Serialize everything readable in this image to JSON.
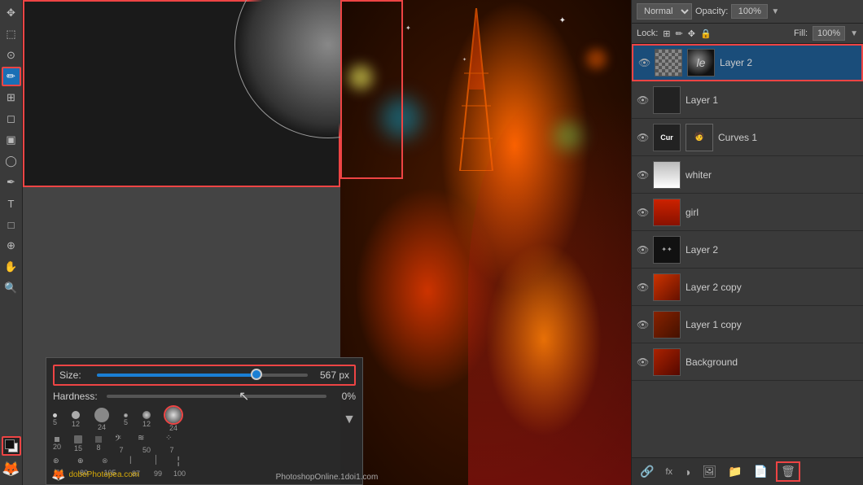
{
  "toolbar": {
    "tools": [
      {
        "name": "move",
        "icon": "✥",
        "active": false
      },
      {
        "name": "marquee",
        "icon": "⬚",
        "active": false
      },
      {
        "name": "lasso",
        "icon": "⊙",
        "active": false
      },
      {
        "name": "brush",
        "icon": "✏",
        "active": true
      },
      {
        "name": "eraser",
        "icon": "◻",
        "active": false
      },
      {
        "name": "gradient",
        "icon": "▣",
        "active": false
      },
      {
        "name": "dodge",
        "icon": "◯",
        "active": false
      },
      {
        "name": "pen",
        "icon": "✒",
        "active": false
      },
      {
        "name": "text",
        "icon": "T",
        "active": false
      },
      {
        "name": "shape",
        "icon": "□",
        "active": false
      },
      {
        "name": "zoom",
        "icon": "🔍",
        "active": false
      },
      {
        "name": "hand",
        "icon": "✋",
        "active": false
      },
      {
        "name": "zoom2",
        "icon": "⊕",
        "active": false
      }
    ]
  },
  "brush": {
    "size_label": "Size:",
    "size_value": "567 px",
    "size_percent": 75,
    "hardness_label": "Hardness:",
    "hardness_value": "0%",
    "presets": [
      {
        "size": 5,
        "type": "small"
      },
      {
        "size": 12,
        "type": "medium"
      },
      {
        "size": 24,
        "type": "large"
      },
      {
        "size": 5,
        "type": "soft-small"
      },
      {
        "size": 12,
        "type": "soft-medium"
      },
      {
        "size": 24,
        "type": "selected"
      }
    ],
    "presets2": [
      {
        "size": 20
      },
      {
        "size": 15
      },
      {
        "size": 8
      },
      {
        "size": 7
      },
      {
        "size": 50
      },
      {
        "size": 7
      }
    ],
    "presets3": [
      {
        "size": 78
      },
      {
        "size": 80
      },
      {
        "size": 105
      },
      {
        "size": 87
      },
      {
        "size": 99
      },
      {
        "size": 100
      }
    ]
  },
  "layers_panel": {
    "blend_mode": "Normal",
    "opacity_label": "Opacity:",
    "opacity_value": "100%",
    "lock_label": "Lock:",
    "fill_label": "Fill:",
    "fill_value": "100%",
    "layers": [
      {
        "name": "Layer 2",
        "type": "checker",
        "visible": true,
        "active": true,
        "mask": true
      },
      {
        "name": "Layer 1",
        "type": "dark",
        "visible": true,
        "active": false
      },
      {
        "name": "Curves 1",
        "type": "curves",
        "visible": true,
        "active": false,
        "label": "Cur"
      },
      {
        "name": "whiter",
        "type": "white",
        "visible": true,
        "active": false
      },
      {
        "name": "girl",
        "type": "red",
        "visible": true,
        "active": false
      },
      {
        "name": "Layer 2",
        "type": "stars",
        "visible": true,
        "active": false
      },
      {
        "name": "Layer 2 copy",
        "type": "photo",
        "visible": true,
        "active": false
      },
      {
        "name": "Layer 1 copy",
        "type": "photo",
        "visible": true,
        "active": false
      },
      {
        "name": "Background",
        "type": "photo",
        "visible": true,
        "active": false
      }
    ],
    "bottom_actions": [
      "🔗",
      "fx",
      "◑",
      "🖼",
      "📁",
      "🗑"
    ]
  },
  "watermarks": {
    "left": "dobePhotopea.com",
    "center": "PhotoshopOnline.1doi1.com"
  }
}
